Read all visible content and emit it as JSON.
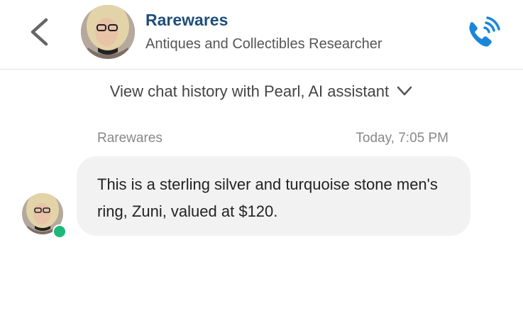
{
  "header": {
    "name": "Rarewares",
    "role": "Antiques and Collectibles Researcher",
    "back_icon": "chevron-left-icon",
    "call_icon": "phone-ringing-icon",
    "accent_color": "#1a86d8",
    "name_color": "#1f4e79"
  },
  "history_toggle": {
    "label": "View chat history with Pearl, AI assistant",
    "icon": "chevron-down-icon"
  },
  "message": {
    "sender": "Rarewares",
    "time": "Today, 7:05 PM",
    "text": "This is a sterling silver and turquoise stone men's ring, Zuni, valued at $120.",
    "online": true,
    "online_color": "#1db87a"
  }
}
